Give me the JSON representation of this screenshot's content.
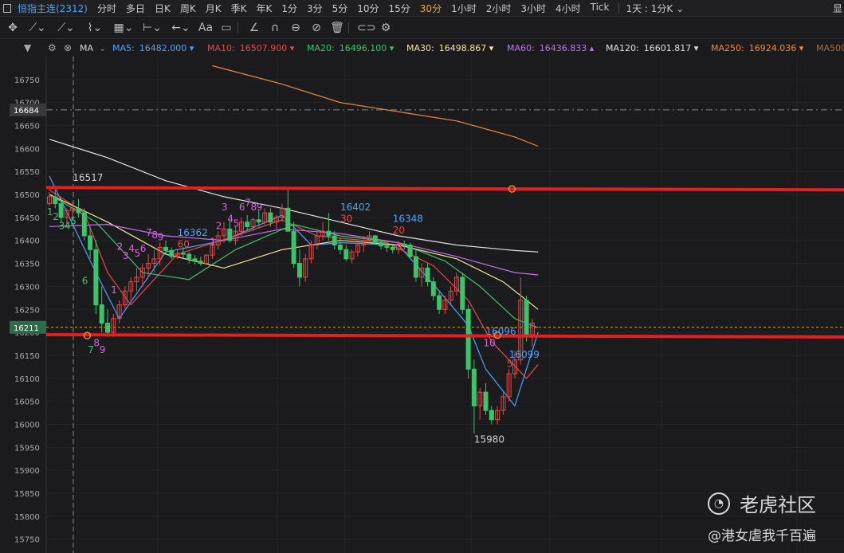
{
  "toolbar": {
    "symbol": "恒指主连(2312)",
    "periods": [
      "分时",
      "多日",
      "日K",
      "周K",
      "月K",
      "季K",
      "年K",
      "1分",
      "3分",
      "5分",
      "10分",
      "15分",
      "30分",
      "1小时",
      "2小时",
      "3小时",
      "4小时",
      "Tick"
    ],
    "active_period": "30分",
    "range_label": "1天 : 1分K ⌄",
    "right_label": "显"
  },
  "drawing_tools": [
    "✥",
    "⟋⌄",
    "⟋⌄",
    "⌇⌄",
    "▦⌄",
    "⊢⌄",
    "←⌄",
    "Aa",
    "▭",
    "∠",
    "∩",
    "⊖",
    "⊘",
    "🗑",
    "⊂⊃",
    "⚙"
  ],
  "indicator_bar": {
    "menu_label": "▼",
    "name": "MA",
    "averages": [
      {
        "name": "MA5:",
        "value": "16482.000",
        "arrow": "▾",
        "color": "#4aa3ff"
      },
      {
        "name": "MA10:",
        "value": "16507.900",
        "arrow": "▾",
        "color": "#e84848"
      },
      {
        "name": "MA20:",
        "value": "16496.100",
        "arrow": "▾",
        "color": "#3cc36b"
      },
      {
        "name": "MA30:",
        "value": "16498.867",
        "arrow": "▾",
        "color": "#f4e59a"
      },
      {
        "name": "MA60:",
        "value": "16436.833",
        "arrow": "▴",
        "color": "#c070f0"
      },
      {
        "name": "MA120:",
        "value": "16601.817",
        "arrow": "▾",
        "color": "#e0e0e0"
      },
      {
        "name": "MA250:",
        "value": "16924.036",
        "arrow": "▾",
        "color": "#f08a3c"
      },
      {
        "name": "MA500",
        "value": "",
        "arrow": "",
        "color": "#b06a32"
      }
    ]
  },
  "chart_data": {
    "type": "candlestick",
    "ylim": [
      15720,
      16800
    ],
    "y_ticks": [
      15750,
      15800,
      15850,
      15900,
      15950,
      16000,
      16050,
      16100,
      16150,
      16200,
      16250,
      16300,
      16350,
      16400,
      16450,
      16500,
      16550,
      16600,
      16650,
      16700,
      16750
    ],
    "y_tick_labels": [
      "15750",
      "15800",
      "15850",
      "15900",
      "15950",
      "16000",
      "16050",
      "16100",
      "16150",
      "16200",
      "16250",
      "16300",
      "16350",
      "16400",
      "16450",
      "16500",
      "16550",
      "16600",
      "16650",
      "16700",
      "16750"
    ],
    "crosshair_price": "16684",
    "current_price": "16211",
    "up_color": "#e84848",
    "down_color": "#3cc36b",
    "candles": [
      [
        16480,
        16505,
        16475,
        16495
      ],
      [
        16495,
        16510,
        16470,
        16480
      ],
      [
        16480,
        16492,
        16440,
        16450
      ],
      [
        16450,
        16470,
        16430,
        16465
      ],
      [
        16465,
        16485,
        16445,
        16470
      ],
      [
        16470,
        16490,
        16450,
        16460
      ],
      [
        16460,
        16470,
        16400,
        16410
      ],
      [
        16410,
        16430,
        16360,
        16380
      ],
      [
        16380,
        16400,
        16240,
        16260
      ],
      [
        16260,
        16300,
        16200,
        16220
      ],
      [
        16220,
        16250,
        16190,
        16200
      ],
      [
        16200,
        16240,
        16190,
        16230
      ],
      [
        16230,
        16270,
        16220,
        16260
      ],
      [
        16260,
        16300,
        16250,
        16290
      ],
      [
        16290,
        16320,
        16270,
        16310
      ],
      [
        16310,
        16340,
        16290,
        16320
      ],
      [
        16320,
        16350,
        16300,
        16340
      ],
      [
        16340,
        16370,
        16320,
        16350
      ],
      [
        16350,
        16380,
        16330,
        16360
      ],
      [
        16360,
        16395,
        16345,
        16385
      ],
      [
        16385,
        16400,
        16370,
        16378
      ],
      [
        16378,
        16385,
        16360,
        16365
      ],
      [
        16365,
        16380,
        16360,
        16372
      ],
      [
        16372,
        16385,
        16362,
        16370
      ],
      [
        16370,
        16375,
        16350,
        16360
      ],
      [
        16360,
        16368,
        16348,
        16355
      ],
      [
        16355,
        16365,
        16345,
        16350
      ],
      [
        16350,
        16370,
        16348,
        16368
      ],
      [
        16368,
        16395,
        16360,
        16390
      ],
      [
        16390,
        16420,
        16380,
        16410
      ],
      [
        16410,
        16440,
        16395,
        16425
      ],
      [
        16425,
        16445,
        16395,
        16400
      ],
      [
        16400,
        16430,
        16390,
        16420
      ],
      [
        16420,
        16450,
        16410,
        16440
      ],
      [
        16440,
        16455,
        16420,
        16430
      ],
      [
        16430,
        16450,
        16420,
        16445
      ],
      [
        16445,
        16465,
        16430,
        16440
      ],
      [
        16440,
        16470,
        16435,
        16460
      ],
      [
        16460,
        16470,
        16430,
        16440
      ],
      [
        16440,
        16455,
        16425,
        16450
      ],
      [
        16450,
        16480,
        16440,
        16470
      ],
      [
        16470,
        16510,
        16450,
        16420
      ],
      [
        16420,
        16440,
        16340,
        16350
      ],
      [
        16350,
        16380,
        16300,
        16320
      ],
      [
        16320,
        16370,
        16310,
        16360
      ],
      [
        16360,
        16400,
        16350,
        16390
      ],
      [
        16390,
        16425,
        16380,
        16410
      ],
      [
        16410,
        16440,
        16400,
        16420
      ],
      [
        16420,
        16460,
        16400,
        16410
      ],
      [
        16410,
        16420,
        16380,
        16390
      ],
      [
        16390,
        16405,
        16370,
        16380
      ],
      [
        16380,
        16390,
        16355,
        16360
      ],
      [
        16360,
        16380,
        16350,
        16375
      ],
      [
        16375,
        16395,
        16365,
        16390
      ],
      [
        16390,
        16410,
        16375,
        16400
      ],
      [
        16400,
        16420,
        16395,
        16410
      ],
      [
        16410,
        16412,
        16390,
        16395
      ],
      [
        16395,
        16402,
        16380,
        16388
      ],
      [
        16388,
        16395,
        16375,
        16385
      ],
      [
        16385,
        16390,
        16372,
        16380
      ],
      [
        16380,
        16398,
        16370,
        16392
      ],
      [
        16392,
        16400,
        16380,
        16390
      ],
      [
        16390,
        16395,
        16360,
        16365
      ],
      [
        16365,
        16380,
        16310,
        16320
      ],
      [
        16320,
        16350,
        16300,
        16340
      ],
      [
        16340,
        16350,
        16300,
        16310
      ],
      [
        16310,
        16320,
        16270,
        16280
      ],
      [
        16280,
        16290,
        16240,
        16250
      ],
      [
        16250,
        16280,
        16240,
        16270
      ],
      [
        16270,
        16300,
        16260,
        16290
      ],
      [
        16290,
        16330,
        16280,
        16320
      ],
      [
        16320,
        16330,
        16240,
        16250
      ],
      [
        16250,
        16260,
        16100,
        16120
      ],
      [
        16120,
        16140,
        15980,
        16040
      ],
      [
        16040,
        16080,
        16010,
        16070
      ],
      [
        16070,
        16090,
        16020,
        16030
      ],
      [
        16030,
        16040,
        16000,
        16010
      ],
      [
        16010,
        16040,
        16000,
        16030
      ],
      [
        16030,
        16070,
        16020,
        16060
      ],
      [
        16060,
        16120,
        16050,
        16110
      ],
      [
        16110,
        16160,
        16100,
        16140
      ],
      [
        16140,
        16320,
        16130,
        16270
      ],
      [
        16270,
        16280,
        16180,
        16195
      ],
      [
        16195,
        16230,
        16170,
        16220
      ]
    ],
    "moving_averages": [
      {
        "name": "MA5",
        "color": "#4aa3ff",
        "points": [
          [
            0,
            16540
          ],
          [
            8,
            16330
          ],
          [
            12,
            16230
          ],
          [
            20,
            16375
          ],
          [
            30,
            16400
          ],
          [
            40,
            16455
          ],
          [
            45,
            16390
          ],
          [
            50,
            16395
          ],
          [
            60,
            16390
          ],
          [
            67,
            16290
          ],
          [
            72,
            16215
          ],
          [
            75,
            16120
          ],
          [
            80,
            16040
          ],
          [
            84,
            16200
          ]
        ]
      },
      {
        "name": "MA10",
        "color": "#e84848",
        "points": [
          [
            0,
            16510
          ],
          [
            6,
            16460
          ],
          [
            10,
            16330
          ],
          [
            14,
            16260
          ],
          [
            22,
            16370
          ],
          [
            32,
            16410
          ],
          [
            40,
            16445
          ],
          [
            46,
            16410
          ],
          [
            58,
            16395
          ],
          [
            66,
            16345
          ],
          [
            72,
            16270
          ],
          [
            76,
            16180
          ],
          [
            82,
            16100
          ],
          [
            84,
            16130
          ]
        ]
      },
      {
        "name": "MA20",
        "color": "#3cc36b",
        "points": [
          [
            0,
            16500
          ],
          [
            8,
            16440
          ],
          [
            16,
            16330
          ],
          [
            24,
            16315
          ],
          [
            32,
            16380
          ],
          [
            42,
            16435
          ],
          [
            50,
            16410
          ],
          [
            60,
            16395
          ],
          [
            68,
            16355
          ],
          [
            74,
            16300
          ],
          [
            80,
            16230
          ],
          [
            84,
            16210
          ]
        ]
      },
      {
        "name": "MA30",
        "color": "#f4e59a",
        "points": [
          [
            0,
            16500
          ],
          [
            10,
            16440
          ],
          [
            20,
            16370
          ],
          [
            30,
            16340
          ],
          [
            40,
            16380
          ],
          [
            50,
            16400
          ],
          [
            60,
            16390
          ],
          [
            70,
            16360
          ],
          [
            78,
            16310
          ],
          [
            84,
            16250
          ]
        ]
      },
      {
        "name": "MA60",
        "color": "#c070f0",
        "points": [
          [
            0,
            16430
          ],
          [
            10,
            16435
          ],
          [
            20,
            16410
          ],
          [
            30,
            16400
          ],
          [
            40,
            16425
          ],
          [
            50,
            16415
          ],
          [
            60,
            16395
          ],
          [
            70,
            16365
          ],
          [
            80,
            16330
          ],
          [
            84,
            16325
          ]
        ]
      },
      {
        "name": "MA120",
        "color": "#e0e0e0",
        "points": [
          [
            0,
            16620
          ],
          [
            10,
            16580
          ],
          [
            20,
            16530
          ],
          [
            30,
            16495
          ],
          [
            40,
            16470
          ],
          [
            50,
            16440
          ],
          [
            60,
            16410
          ],
          [
            70,
            16390
          ],
          [
            80,
            16378
          ],
          [
            84,
            16375
          ]
        ]
      },
      {
        "name": "MA250",
        "color": "#f08a3c",
        "points": [
          [
            28,
            16780
          ],
          [
            40,
            16740
          ],
          [
            50,
            16700
          ],
          [
            60,
            16680
          ],
          [
            70,
            16660
          ],
          [
            80,
            16625
          ],
          [
            84,
            16605
          ]
        ]
      }
    ],
    "annotations": [
      {
        "text": "16517",
        "price": 16530,
        "i": 4,
        "color": "#d0d0d0"
      },
      {
        "text": "16362",
        "price": 16410,
        "i": 22,
        "color": "#4aa3ff"
      },
      {
        "text": "60",
        "price": 16385,
        "i": 22,
        "color": "#e84848"
      },
      {
        "text": "16402",
        "price": 16465,
        "i": 50,
        "color": "#4aa3ff"
      },
      {
        "text": "30",
        "price": 16440,
        "i": 50,
        "color": "#e84848"
      },
      {
        "text": "16348",
        "price": 16440,
        "i": 59,
        "color": "#4aa3ff"
      },
      {
        "text": "20",
        "price": 16415,
        "i": 59,
        "color": "#e84848"
      },
      {
        "text": "16099",
        "price": 16145,
        "i": 79,
        "color": "#4aa3ff"
      },
      {
        "text": "15980",
        "price": 15960,
        "i": 73,
        "color": "#d0d0d0"
      },
      {
        "text": "16096",
        "price": 16195,
        "i": 75,
        "color": "#4aa3ff"
      }
    ],
    "td_counts": [
      {
        "text": "1",
        "i": 0,
        "price": 16455,
        "color": "#3cc36b"
      },
      {
        "text": "2",
        "i": 1,
        "price": 16445,
        "color": "#3cc36b"
      },
      {
        "text": "3",
        "i": 2,
        "price": 16425,
        "color": "#3cc36b"
      },
      {
        "text": "4",
        "i": 3,
        "price": 16425,
        "color": "#3cc36b"
      },
      {
        "text": "5",
        "i": 4,
        "price": 16435,
        "color": "#3cc36b"
      },
      {
        "text": "6",
        "i": 6,
        "price": 16305,
        "color": "#3cc36b"
      },
      {
        "text": "7",
        "i": 7,
        "price": 16155,
        "color": "#3cc36b"
      },
      {
        "text": "8",
        "i": 8,
        "price": 16170,
        "color": "#e060e0"
      },
      {
        "text": "9",
        "i": 9,
        "price": 16155,
        "color": "#e060e0"
      },
      {
        "text": "1",
        "i": 11,
        "price": 16285,
        "color": "#e060e0"
      },
      {
        "text": "2",
        "i": 12,
        "price": 16380,
        "color": "#e060e0"
      },
      {
        "text": "3",
        "i": 13,
        "price": 16360,
        "color": "#e060e0"
      },
      {
        "text": "4",
        "i": 14,
        "price": 16375,
        "color": "#e060e0"
      },
      {
        "text": "5",
        "i": 15,
        "price": 16365,
        "color": "#e060e0"
      },
      {
        "text": "6",
        "i": 16,
        "price": 16375,
        "color": "#e060e0"
      },
      {
        "text": "7",
        "i": 17,
        "price": 16410,
        "color": "#e060e0"
      },
      {
        "text": "8",
        "i": 18,
        "price": 16405,
        "color": "#e060e0"
      },
      {
        "text": "9",
        "i": 19,
        "price": 16400,
        "color": "#e060e0"
      },
      {
        "text": "1",
        "i": 28,
        "price": 16390,
        "color": "#e060e0"
      },
      {
        "text": "2",
        "i": 29,
        "price": 16425,
        "color": "#e060e0"
      },
      {
        "text": "3",
        "i": 30,
        "price": 16465,
        "color": "#e060e0"
      },
      {
        "text": "4",
        "i": 31,
        "price": 16440,
        "color": "#e060e0"
      },
      {
        "text": "5",
        "i": 32,
        "price": 16430,
        "color": "#e060e0"
      },
      {
        "text": "6",
        "i": 33,
        "price": 16465,
        "color": "#e060e0"
      },
      {
        "text": "7",
        "i": 34,
        "price": 16475,
        "color": "#e060e0"
      },
      {
        "text": "8",
        "i": 35,
        "price": 16465,
        "color": "#e060e0"
      },
      {
        "text": "9",
        "i": 36,
        "price": 16465,
        "color": "#e060e0"
      },
      {
        "text": "10",
        "i": 75,
        "price": 16170,
        "color": "#e060e0"
      },
      {
        "text": "5",
        "i": 79,
        "price": 16125,
        "color": "#e84848"
      }
    ],
    "horizontal_lines": [
      {
        "y1": 16510,
        "y2": 16515,
        "color": "#e61e1e"
      },
      {
        "y1": 16190,
        "y2": 16195,
        "color": "#e61e1e"
      }
    ],
    "markers": [
      {
        "i": 6.5,
        "price": 16193
      },
      {
        "i": 77,
        "price": 16194
      },
      {
        "i": 79.5,
        "price": 16512
      }
    ]
  },
  "watermark": {
    "brand": "老虎社区",
    "author": "@港女虐我千百遍"
  }
}
